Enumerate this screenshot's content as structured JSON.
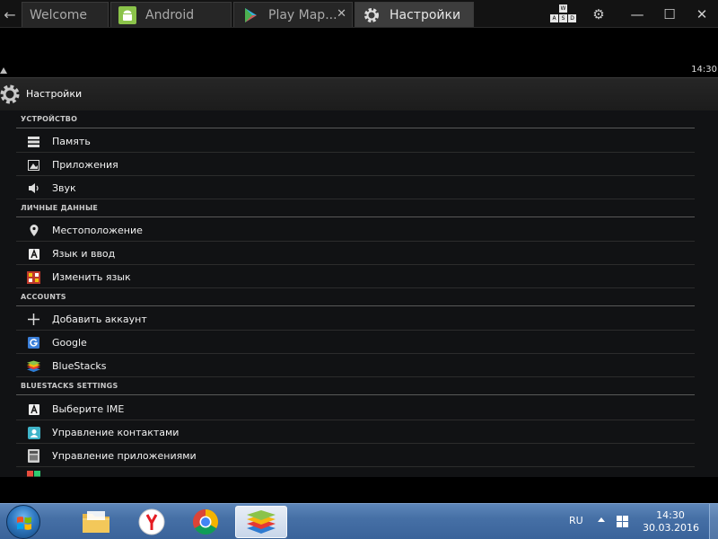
{
  "tabs": [
    {
      "label": "Welcome",
      "icon": "none",
      "active": false
    },
    {
      "label": "Android",
      "icon": "android-icon",
      "active": false
    },
    {
      "label": "Play Map...",
      "icon": "play-store-icon",
      "active": false
    },
    {
      "label": "Настройки",
      "icon": "gear-icon",
      "active": true
    }
  ],
  "window_controls": {
    "keymap_keys": [
      "W",
      "A",
      "S",
      "D"
    ],
    "settings": "⚙",
    "minimize": "—",
    "maximize": "☐",
    "close": "✕"
  },
  "status_bar": {
    "time": "14:30"
  },
  "action_bar": {
    "title": "Настройки"
  },
  "settings": {
    "sections": [
      {
        "header": "УСТРОЙСТВО",
        "items": [
          {
            "label": "Память",
            "icon": "storage-icon"
          },
          {
            "label": "Приложения",
            "icon": "apps-icon"
          },
          {
            "label": "Звук",
            "icon": "sound-icon"
          }
        ]
      },
      {
        "header": "ЛИЧНЫЕ ДАННЫЕ",
        "items": [
          {
            "label": "Местоположение",
            "icon": "location-icon"
          },
          {
            "label": "Язык и ввод",
            "icon": "language-icon"
          },
          {
            "label": "Изменить язык",
            "icon": "change-language-icon"
          }
        ]
      },
      {
        "header": "ACCOUNTS",
        "items": [
          {
            "label": "Добавить аккаунт",
            "icon": "plus-icon"
          },
          {
            "label": "Google",
            "icon": "google-icon"
          },
          {
            "label": "BlueStacks",
            "icon": "bluestacks-icon"
          }
        ]
      },
      {
        "header": "BLUESTACKS SETTINGS",
        "items": [
          {
            "label": "Выберите IME",
            "icon": "ime-icon"
          },
          {
            "label": "Управление контактами",
            "icon": "contacts-icon"
          },
          {
            "label": "Управление приложениями",
            "icon": "manage-apps-icon"
          }
        ]
      }
    ]
  },
  "taskbar": {
    "language": "RU",
    "time": "14:30",
    "date": "30.03.2016"
  },
  "colors": {
    "tab_active": "#3d3d3d",
    "android_bg": "#111214",
    "section_divider": "#595959",
    "taskbar_blue": "#4670a6"
  }
}
